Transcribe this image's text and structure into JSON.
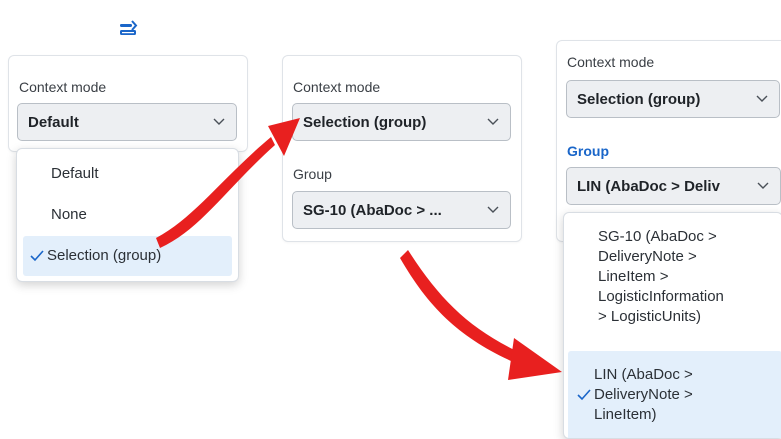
{
  "toolbar": {
    "icon": "context-mode-icon",
    "color": "#1a66c9"
  },
  "panel1": {
    "label": "Context mode",
    "select_value": "Default",
    "options": [
      {
        "label": "Default",
        "selected": false
      },
      {
        "label": "None",
        "selected": false
      },
      {
        "label": "Selection (group)",
        "selected": true
      }
    ]
  },
  "panel2": {
    "label": "Context mode",
    "select_value": "Selection (group)",
    "group_label": "Group",
    "group_value": "SG-10 (AbaDoc > ..."
  },
  "panel3": {
    "label": "Context mode",
    "select_value": "Selection (group)",
    "group_label": "Group",
    "group_value": "LIN (AbaDoc > Deliv",
    "options": [
      {
        "lines": [
          "SG-10 (AbaDoc >",
          "DeliveryNote >",
          "LineItem >",
          "LogisticInformation",
          "> LogisticUnits)"
        ],
        "selected": false
      },
      {
        "lines": [
          "LIN (AbaDoc >",
          "DeliveryNote >",
          "LineItem)"
        ],
        "selected": true
      }
    ]
  },
  "colors": {
    "accent": "#1a66c9",
    "arrow": "#e8201f",
    "selected_bg": "#e3effb"
  }
}
